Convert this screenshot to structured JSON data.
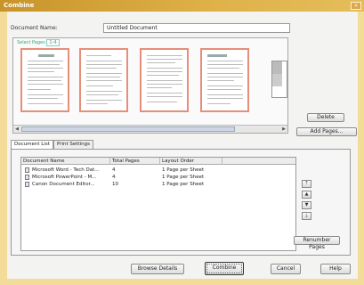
{
  "window": {
    "title": "Combine",
    "close_glyph": "×"
  },
  "document_name": {
    "label": "Document Name:",
    "value": "Untitled Document"
  },
  "preview": {
    "header_label": "Select Pages",
    "header_count": "1-4"
  },
  "buttons": {
    "delete": "Delete",
    "add_pages": "Add Pages...",
    "renumber": "Renumber Pages",
    "browse_details": "Browse Details",
    "combine": "Combine",
    "cancel": "Cancel",
    "help": "Help"
  },
  "tabs": [
    {
      "label": "Document List",
      "active": true
    },
    {
      "label": "Print Settings",
      "active": false
    }
  ],
  "list": {
    "columns": [
      "Document Name",
      "Total Pages",
      "Layout Order"
    ],
    "rows": [
      {
        "name": "Microsoft Word - Tech Dat...",
        "pages": "4",
        "order": "1 Page per Sheet"
      },
      {
        "name": "Microsoft PowerPoint - M...",
        "pages": "4",
        "order": "1 Page per Sheet"
      },
      {
        "name": "Canon Document Editor...",
        "pages": "10",
        "order": "1 Page per Sheet"
      }
    ]
  },
  "side_icons": [
    "move-to-top-icon",
    "move-up-icon",
    "move-down-icon",
    "move-to-bottom-icon"
  ],
  "side_glyphs": [
    "⤒",
    "▲",
    "▼",
    "⤓"
  ],
  "scroll_glyphs": {
    "left": "◀",
    "right": "▶"
  },
  "colors": {
    "title_bar": "#d6a53e",
    "frame": "#f2dc98",
    "thumb_border": "#e58e7a"
  }
}
